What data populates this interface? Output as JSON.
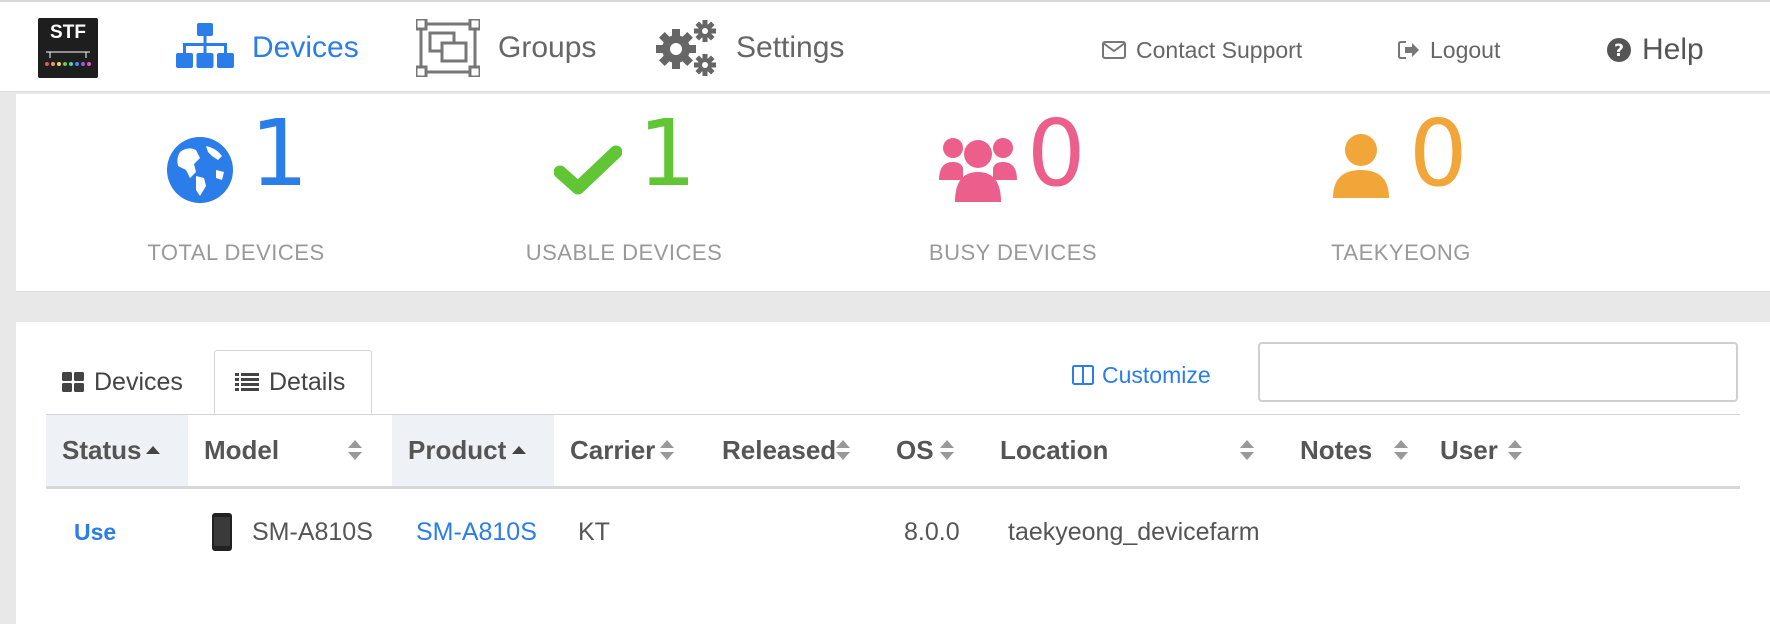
{
  "app": {
    "logo_text": "STF"
  },
  "nav": {
    "items": [
      {
        "label": "Devices",
        "icon": "sitemap-icon",
        "active": true
      },
      {
        "label": "Groups",
        "icon": "object-group-icon",
        "active": false
      },
      {
        "label": "Settings",
        "icon": "gears-icon",
        "active": false
      }
    ],
    "contact_support": "Contact Support",
    "logout": "Logout",
    "help": "Help"
  },
  "stats": [
    {
      "value": "1",
      "caption": "TOTAL DEVICES",
      "icon": "globe-icon",
      "color": "#2b7de9"
    },
    {
      "value": "1",
      "caption": "USABLE DEVICES",
      "icon": "check-icon",
      "color": "#62c536"
    },
    {
      "value": "0",
      "caption": "BUSY DEVICES",
      "icon": "users-icon",
      "color": "#ec5f8c"
    },
    {
      "value": "0",
      "caption": "TAEKYEONG",
      "icon": "user-icon",
      "color": "#f2a63a"
    }
  ],
  "device_panel": {
    "tabs": [
      {
        "label": "Devices",
        "icon": "th-large-icon",
        "active": false
      },
      {
        "label": "Details",
        "icon": "list-icon",
        "active": true
      }
    ],
    "customize_label": "Customize",
    "search": {
      "value": "",
      "placeholder": ""
    },
    "columns": [
      {
        "label": "Status",
        "sort": "asc"
      },
      {
        "label": "Model",
        "sort": "none"
      },
      {
        "label": "Product",
        "sort": "asc"
      },
      {
        "label": "Carrier",
        "sort": "none"
      },
      {
        "label": "Released",
        "sort": "none"
      },
      {
        "label": "OS",
        "sort": "none"
      },
      {
        "label": "Location",
        "sort": "none"
      },
      {
        "label": "Notes",
        "sort": "none"
      },
      {
        "label": "User",
        "sort": "none"
      }
    ],
    "rows": [
      {
        "status": "Use",
        "model": "SM-A810S",
        "product": "SM-A810S",
        "carrier": "KT",
        "released": "",
        "os": "8.0.0",
        "location": "taekyeong_devicefarm",
        "notes": "",
        "user": ""
      }
    ]
  },
  "colors": {
    "accent": "#2b7de9",
    "usable": "#62c536",
    "busy": "#ec5f8c",
    "user": "#f2a63a"
  }
}
